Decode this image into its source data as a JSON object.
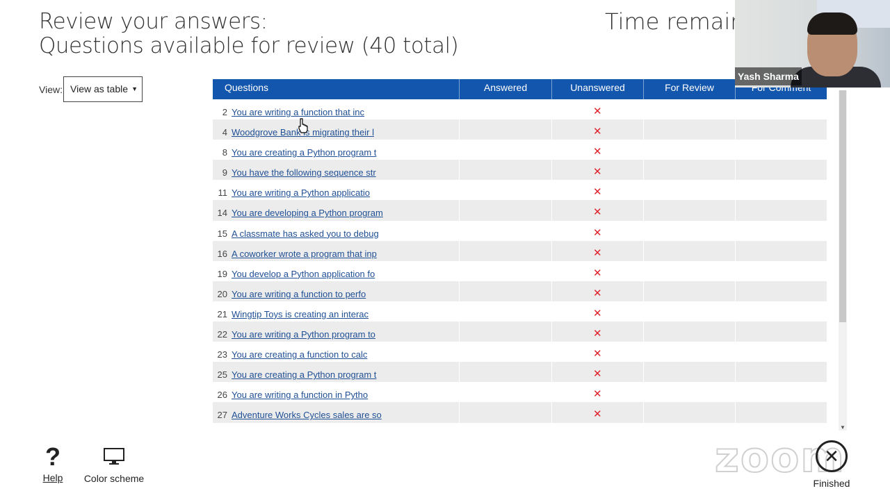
{
  "header": {
    "title_line1": "Review your answers:",
    "title_line2": "Questions available for review (40 total)",
    "timer_label": "Time remainin"
  },
  "view": {
    "label": "View:",
    "selected": "View as table"
  },
  "table": {
    "columns": [
      "Questions",
      "Answered",
      "Unanswered",
      "For Review",
      "For Comment"
    ],
    "rows": [
      {
        "num": "2",
        "text": "You are writing a function that inc",
        "unanswered": true
      },
      {
        "num": "4",
        "text": "Woodgrove Bank is migrating their l",
        "unanswered": true
      },
      {
        "num": "8",
        "text": "You are creating a Python program t",
        "unanswered": true
      },
      {
        "num": "9",
        "text": "You have the following sequence str",
        "unanswered": true
      },
      {
        "num": "11",
        "text": "You are writing a Python applicatio",
        "unanswered": true
      },
      {
        "num": "14",
        "text": "You are developing a Python program",
        "unanswered": true
      },
      {
        "num": "15",
        "text": "A classmate has asked you to debug",
        "unanswered": true
      },
      {
        "num": "16",
        "text": "A coworker wrote a program that inp",
        "unanswered": true
      },
      {
        "num": "19",
        "text": "You develop a Python application fo",
        "unanswered": true
      },
      {
        "num": "20",
        "text": "You are writing a function to perfo",
        "unanswered": true
      },
      {
        "num": "21",
        "text": "Wingtip Toys is creating an interac",
        "unanswered": true
      },
      {
        "num": "22",
        "text": "You are writing a Python program to",
        "unanswered": true
      },
      {
        "num": "23",
        "text": "You are creating a function to calc",
        "unanswered": true
      },
      {
        "num": "25",
        "text": "You are creating a Python program t",
        "unanswered": true
      },
      {
        "num": "26",
        "text": "You are writing a function in Pytho",
        "unanswered": true
      },
      {
        "num": "27",
        "text": "Adventure Works Cycles sales are so",
        "unanswered": true
      }
    ],
    "unanswered_mark": "✕"
  },
  "video": {
    "participant_name": "Yash Sharma"
  },
  "watermark": "zoom",
  "footer": {
    "help_glyph": "?",
    "help_label": "Help",
    "color_label": "Color scheme",
    "finished_glyph": "✕",
    "finished_label": "Finished"
  },
  "colors": {
    "header_blue": "#1356ad",
    "link": "#1f4f95",
    "x_red": "#e0202a",
    "alt_row": "#ececec"
  }
}
